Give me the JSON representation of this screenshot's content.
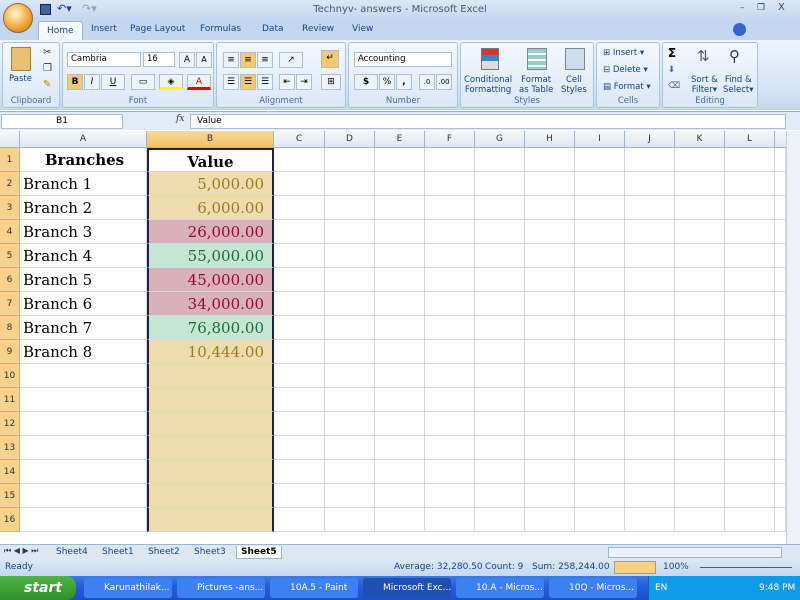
{
  "window": {
    "title": "Technyv- answers - Microsoft Excel"
  },
  "ribbon_tabs": [
    "Home",
    "Insert",
    "Page Layout",
    "Formulas",
    "Data",
    "Review",
    "View"
  ],
  "ribbon": {
    "clipboard": {
      "label": "Clipboard",
      "paste": "Paste"
    },
    "font": {
      "label": "Font",
      "font_name": "Cambria",
      "font_size": "16",
      "bold": "B",
      "italic": "I",
      "underline": "U"
    },
    "alignment": {
      "label": "Alignment"
    },
    "number": {
      "label": "Number",
      "format": "Accounting",
      "currency": "$",
      "percent": "%",
      "comma": ","
    },
    "styles": {
      "label": "Styles",
      "conditional": "Conditional",
      "conditional2": "Formatting",
      "format_table": "Format",
      "format_table2": "as Table",
      "cell_styles": "Cell",
      "cell_styles2": "Styles"
    },
    "cells": {
      "label": "Cells",
      "insert": "Insert",
      "delete": "Delete",
      "format": "Format"
    },
    "editing": {
      "label": "Editing",
      "sort": "Sort &",
      "sort2": "Filter",
      "find": "Find &",
      "find2": "Select",
      "sigma": "Σ"
    }
  },
  "formula_bar": {
    "name_box": "B1",
    "fx": "fx",
    "value": "Value"
  },
  "columns": [
    "A",
    "B",
    "C",
    "D",
    "E",
    "F",
    "G",
    "H",
    "I",
    "J",
    "K",
    "L"
  ],
  "rows": [
    "1",
    "2",
    "3",
    "4",
    "5",
    "6",
    "7",
    "8",
    "9",
    "10",
    "11",
    "12",
    "13",
    "14",
    "15",
    "16"
  ],
  "table": {
    "headers": [
      "Branches",
      "Value"
    ],
    "rows": [
      {
        "branch": "Branch 1",
        "value": "5,000.00",
        "status": "neutral"
      },
      {
        "branch": "Branch 2",
        "value": "6,000.00",
        "status": "neutral"
      },
      {
        "branch": "Branch 3",
        "value": "26,000.00",
        "status": "bad"
      },
      {
        "branch": "Branch 4",
        "value": "55,000.00",
        "status": "good"
      },
      {
        "branch": "Branch 5",
        "value": "45,000.00",
        "status": "bad"
      },
      {
        "branch": "Branch 6",
        "value": "34,000.00",
        "status": "bad"
      },
      {
        "branch": "Branch 7",
        "value": "76,800.00",
        "status": "good"
      },
      {
        "branch": "Branch 8",
        "value": "10,444.00",
        "status": "neutral"
      }
    ]
  },
  "colors": {
    "neutral_bg": "#eedcae",
    "neutral_fg": "#9c7a1e",
    "bad_bg": "#d9b1bc",
    "bad_fg": "#9c0633",
    "good_bg": "#c6e6d4",
    "good_fg": "#1e6a3c"
  },
  "sheet_tabs": [
    "Sheet4",
    "Sheet1",
    "Sheet2",
    "Sheet3",
    "Sheet5"
  ],
  "active_sheet": "Sheet5",
  "status": {
    "mode": "Ready",
    "average": "Average: 32,280.50",
    "count": "Count: 9",
    "sum": "Sum: 258,244.00",
    "zoom": "100%"
  },
  "taskbar": {
    "start": "start",
    "tasks": [
      "Karunathilak...",
      "Pictures -ans...",
      "10A.5 - Paint",
      "Microsoft Exc...",
      "10.A - Micros...",
      "10Q - Micros..."
    ],
    "active_task": "Microsoft Exc...",
    "lang": "EN",
    "clock": "9:48 PM"
  }
}
